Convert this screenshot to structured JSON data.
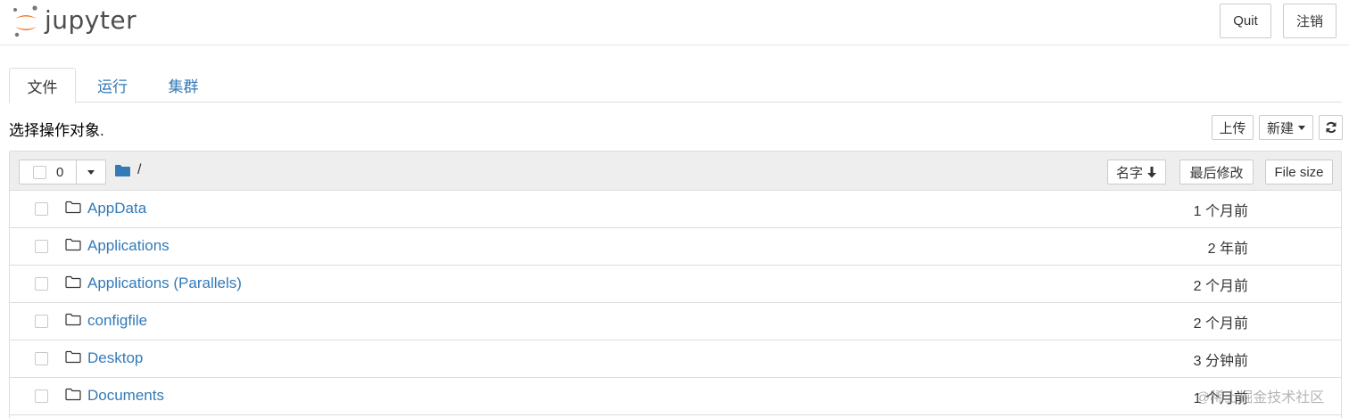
{
  "header": {
    "logo_text": "jupyter",
    "quit_label": "Quit",
    "logout_label": "注销"
  },
  "tabs": [
    {
      "label": "文件",
      "active": true
    },
    {
      "label": "运行",
      "active": false
    },
    {
      "label": "集群",
      "active": false
    }
  ],
  "toolbar": {
    "hint": "选择操作对象.",
    "upload_label": "上传",
    "new_label": "新建",
    "refresh_icon": "refresh-icon"
  },
  "list_header": {
    "selected_count": "0",
    "breadcrumb": "/",
    "sort_name_label": "名字",
    "last_modified_label": "最后修改",
    "file_size_label": "File size"
  },
  "files": [
    {
      "name": "AppData",
      "modified": "1 个月前",
      "icon": "folder-icon"
    },
    {
      "name": "Applications",
      "modified": "2 年前",
      "icon": "folder-icon"
    },
    {
      "name": "Applications (Parallels)",
      "modified": "2 个月前",
      "icon": "folder-icon"
    },
    {
      "name": "configfile",
      "modified": "2 个月前",
      "icon": "folder-icon"
    },
    {
      "name": "Desktop",
      "modified": "3 分钟前",
      "icon": "folder-icon"
    },
    {
      "name": "Documents",
      "modified": "1 个月前",
      "icon": "folder-icon"
    }
  ],
  "watermark": "@稀土掘金技术社区",
  "colors": {
    "link": "#337ab7",
    "logo_orange": "#f37726",
    "logo_gray": "#767677",
    "header_bg": "#eeeeee",
    "border": "#dddddd"
  }
}
